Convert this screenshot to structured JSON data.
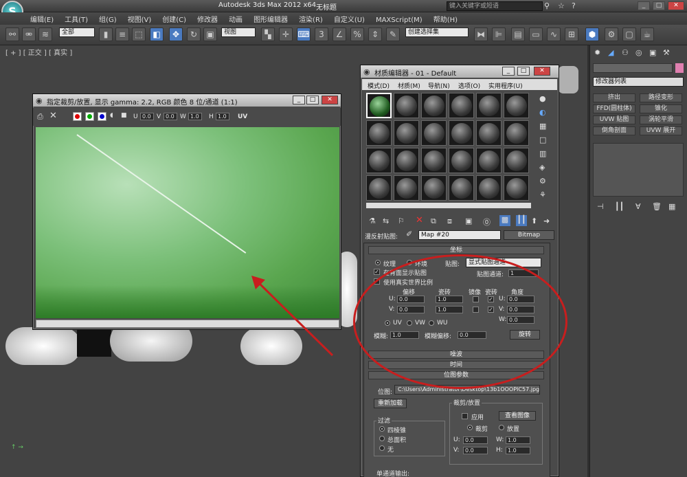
{
  "app": {
    "title": "Autodesk 3ds Max  2012 x64",
    "doc": "无标题",
    "search_placeholder": "键入关键字或短语"
  },
  "menu": [
    "编辑(E)",
    "工具(T)",
    "组(G)",
    "视图(V)",
    "创建(C)",
    "修改器",
    "动画",
    "图形编辑器",
    "渲染(R)",
    "自定义(U)",
    "MAXScript(M)",
    "帮助(H)"
  ],
  "toolbar": {
    "filter": "全部",
    "view": "视图",
    "named_sel": "创建选择集"
  },
  "viewport": {
    "label": "[ + ] [ 正交 ] [ 真实 ]"
  },
  "cmdpanel": {
    "modifier_list": "修改器列表",
    "buttons": [
      "挤出",
      "路径变形",
      "FFD(圆柱体)",
      "锥化",
      "UVW 贴图",
      "涡轮平滑",
      "倒角剖面",
      "UVW 展开"
    ]
  },
  "bitmapwin": {
    "title": "指定裁剪/放置, 显示 gamma: 2.2, RGB 颜色 8 位/通道 (1:1)",
    "u_label": "U",
    "u": "0.0",
    "v_label": "V",
    "v": "0.0",
    "w_label": "W",
    "w": "1.0",
    "h_label": "H",
    "h": "1.0",
    "uv": "UV"
  },
  "mateditor": {
    "title": "材质编辑器 - 01 - Default",
    "menus": [
      "模式(D)",
      "材质(M)",
      "导航(N)",
      "选项(O)",
      "实用程序(U)"
    ],
    "map_label": "漫反射贴图:",
    "map_name": "Map #20",
    "map_type": "Bitmap",
    "coords": {
      "header": "坐标",
      "texture": "纹理",
      "environ": "环境",
      "mapping_label": "贴图:",
      "mapping_value": "显式贴图通道",
      "show_back": "在背面显示贴图",
      "map_channel_label": "贴图通道:",
      "map_channel": "1",
      "real_world": "使用真实世界比例",
      "offset": "偏移",
      "tiling": "瓷砖",
      "mirror": "镜像",
      "tile": "瓷砖",
      "angle": "角度",
      "u_label": "U:",
      "v_label": "V:",
      "w_label": "W:",
      "u_off": "0.0",
      "v_off": "0.0",
      "u_tile": "1.0",
      "v_tile": "1.0",
      "u_ang": "0.0",
      "v_ang": "0.0",
      "w_ang": "0.0",
      "uv": "UV",
      "vw": "VW",
      "wu": "WU",
      "blur_label": "模糊:",
      "blur": "1.0",
      "blur_off_label": "模糊偏移:",
      "blur_off": "0.0",
      "rotate": "旋转"
    },
    "noise": "噪波",
    "time": "时间",
    "bitmap": {
      "header": "位图参数",
      "path_label": "位图:",
      "path": "C:\\Users\\Administrator\\Desktop\\13b1OOOPIC57.jpg",
      "reload": "重新加载",
      "crop_group": "裁剪/放置",
      "apply": "应用",
      "view_image": "查看图像",
      "crop": "裁剪",
      "place": "放置",
      "filter_group": "过滤",
      "pyramid": "四棱锥",
      "summed": "总面积",
      "none": "无",
      "u_label": "U:",
      "v_label": "V:",
      "w_label": "W:",
      "h_label": "H:",
      "u": "0.0",
      "v": "0.0",
      "w": "1.0",
      "h": "1.0",
      "mono_out": "单通道输出:"
    }
  },
  "colors": {
    "annotation": "#c81e1e",
    "accent": "#4a7ac0"
  }
}
